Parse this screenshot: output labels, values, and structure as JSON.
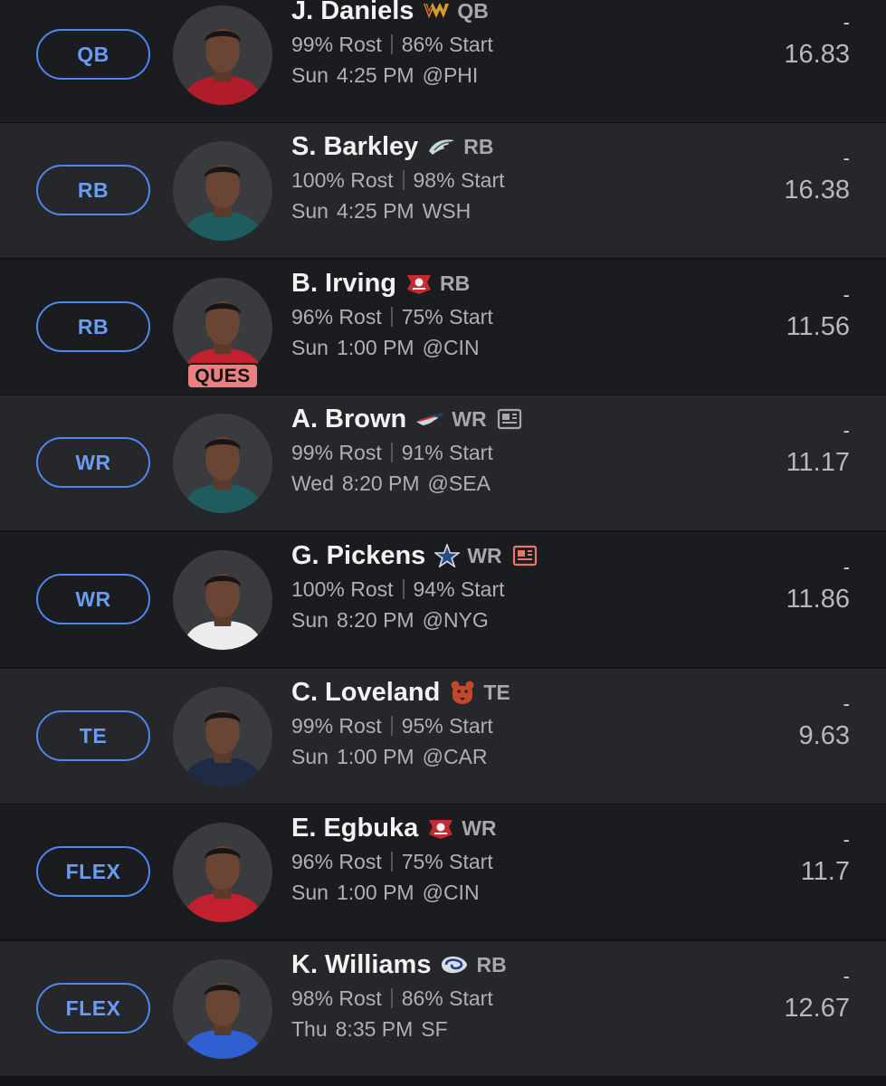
{
  "colors": {
    "slot_accent": "#4f86ee",
    "ques_badge": "#ec8081",
    "row_dark": "#1b1c1f",
    "row_light": "#26272a",
    "news_alert": "#e5776d"
  },
  "players": [
    {
      "slot": "QB",
      "name": "J. Daniels",
      "team_icon": "commanders-logo-icon",
      "pos": "QB",
      "rost": "99% Rost",
      "start": "86% Start",
      "day": "Sun",
      "time": "4:25 PM",
      "opp": "@PHI",
      "dash": "-",
      "proj": "16.83",
      "jersey": "#b11c2a",
      "news": "",
      "status": ""
    },
    {
      "slot": "RB",
      "name": "S. Barkley",
      "team_icon": "eagles-logo-icon",
      "pos": "RB",
      "rost": "100% Rost",
      "start": "98% Start",
      "day": "Sun",
      "time": "4:25 PM",
      "opp": "WSH",
      "dash": "-",
      "proj": "16.38",
      "jersey": "#1e5c5f",
      "news": "",
      "status": ""
    },
    {
      "slot": "RB",
      "name": "B. Irving",
      "team_icon": "buccaneers-logo-icon",
      "pos": "RB",
      "rost": "96% Rost",
      "start": "75% Start",
      "day": "Sun",
      "time": "1:00 PM",
      "opp": "@CIN",
      "dash": "-",
      "proj": "11.56",
      "jersey": "#c3202f",
      "news": "",
      "status": "QUES"
    },
    {
      "slot": "WR",
      "name": "A. Brown",
      "team_icon": "patriots-logo-icon",
      "pos": "WR",
      "rost": "99% Rost",
      "start": "91% Start",
      "day": "Wed",
      "time": "8:20 PM",
      "opp": "@SEA",
      "dash": "-",
      "proj": "11.17",
      "jersey": "#1e5c5f",
      "news": "news-icon",
      "status": ""
    },
    {
      "slot": "WR",
      "name": "G. Pickens",
      "team_icon": "cowboys-logo-icon",
      "pos": "WR",
      "rost": "100% Rost",
      "start": "94% Start",
      "day": "Sun",
      "time": "8:20 PM",
      "opp": "@NYG",
      "dash": "-",
      "proj": "11.86",
      "jersey": "#ececec",
      "news": "news-alert-icon",
      "status": ""
    },
    {
      "slot": "TE",
      "name": "C. Loveland",
      "team_icon": "bears-logo-icon",
      "pos": "TE",
      "rost": "99% Rost",
      "start": "95% Start",
      "day": "Sun",
      "time": "1:00 PM",
      "opp": "@CAR",
      "dash": "-",
      "proj": "9.63",
      "jersey": "#1f2a44",
      "news": "",
      "status": ""
    },
    {
      "slot": "FLEX",
      "name": "E. Egbuka",
      "team_icon": "buccaneers-logo-icon",
      "pos": "WR",
      "rost": "96% Rost",
      "start": "75% Start",
      "day": "Sun",
      "time": "1:00 PM",
      "opp": "@CIN",
      "dash": "-",
      "proj": "11.7",
      "jersey": "#c3202f",
      "news": "",
      "status": ""
    },
    {
      "slot": "FLEX",
      "name": "K. Williams",
      "team_icon": "rams-logo-icon",
      "pos": "RB",
      "rost": "98% Rost",
      "start": "86% Start",
      "day": "Thu",
      "time": "8:35 PM",
      "opp": "SF",
      "dash": "-",
      "proj": "12.67",
      "jersey": "#2f5fd0",
      "news": "",
      "status": ""
    }
  ]
}
